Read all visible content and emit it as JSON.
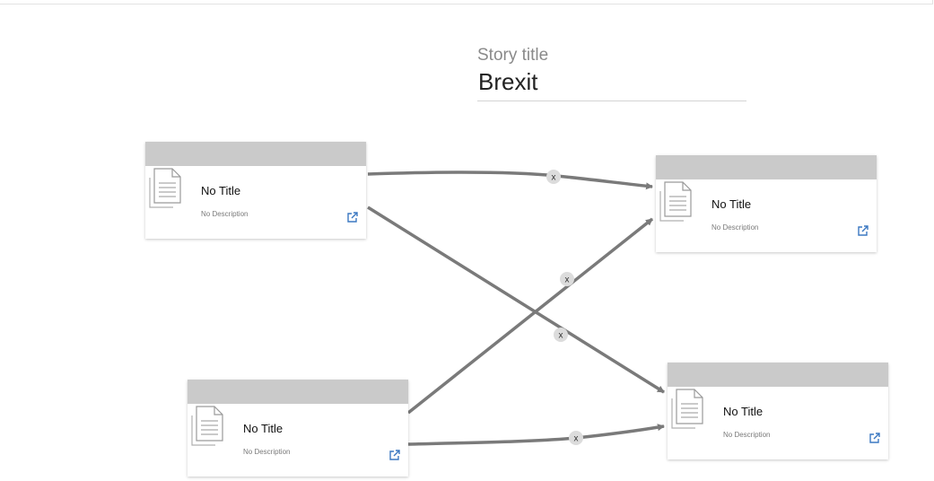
{
  "story": {
    "label": "Story title",
    "title_value": "Brexit"
  },
  "nodes": [
    {
      "id": "n1",
      "title": "No Title",
      "description": "No Description"
    },
    {
      "id": "n2",
      "title": "No Title",
      "description": "No Description"
    },
    {
      "id": "n3",
      "title": "No Title",
      "description": "No Description"
    },
    {
      "id": "n4",
      "title": "No Title",
      "description": "No Description"
    }
  ],
  "edges": [
    {
      "from": "n1",
      "to": "n2",
      "remove_label": "x"
    },
    {
      "from": "n1",
      "to": "n4",
      "remove_label": "x"
    },
    {
      "from": "n3",
      "to": "n2",
      "remove_label": "x"
    },
    {
      "from": "n3",
      "to": "n4",
      "remove_label": "x"
    }
  ],
  "colors": {
    "node_header": "#cacaca",
    "edge": "#7a7a7a",
    "remove_badge": "#dcdcdc",
    "open_icon": "#3b78c2"
  },
  "icons": {
    "node_doc": "document-icon",
    "node_open": "external-link-icon"
  }
}
